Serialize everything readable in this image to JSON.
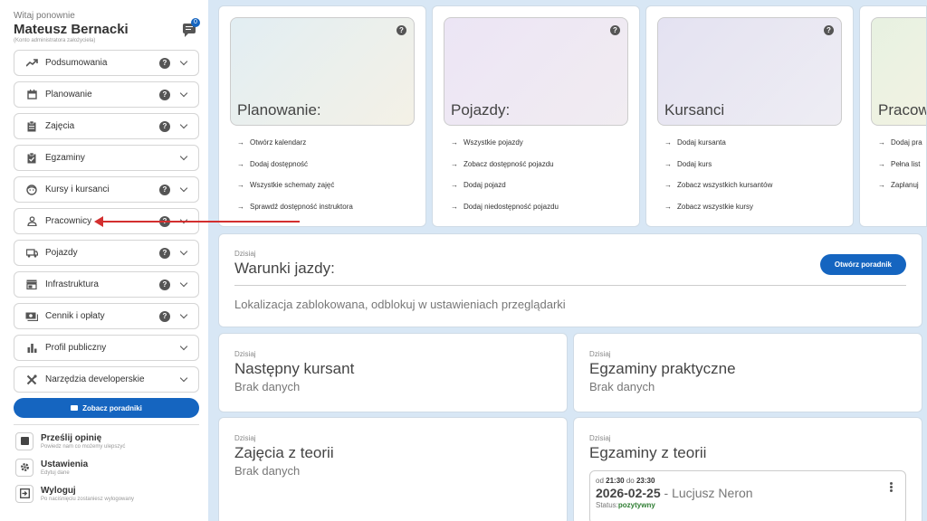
{
  "user": {
    "greeting": "Witaj ponownie",
    "name": "Mateusz Bernacki",
    "role": "(Konto administratora założyciela)",
    "notification_count": "0"
  },
  "menu": [
    {
      "label": "Podsumowania",
      "icon": "trending-up-icon",
      "help": true
    },
    {
      "label": "Planowanie",
      "icon": "calendar-icon",
      "help": true
    },
    {
      "label": "Zajęcia",
      "icon": "clipboard-icon",
      "help": true
    },
    {
      "label": "Egzaminy",
      "icon": "clipboard-check-icon",
      "help": false
    },
    {
      "label": "Kursy i kursanci",
      "icon": "face-icon",
      "help": true
    },
    {
      "label": "Pracownicy",
      "icon": "person-icon",
      "help": true
    },
    {
      "label": "Pojazdy",
      "icon": "car-icon",
      "help": true
    },
    {
      "label": "Infrastruktura",
      "icon": "store-icon",
      "help": true
    },
    {
      "label": "Cennik i opłaty",
      "icon": "payments-icon",
      "help": true
    },
    {
      "label": "Profil publiczny",
      "icon": "bar-chart-icon",
      "help": false
    },
    {
      "label": "Narzędzia developerskie",
      "icon": "tools-icon",
      "help": false
    }
  ],
  "guide_button": "Zobacz poradniki",
  "bottom": [
    {
      "title": "Prześlij opinię",
      "subtitle": "Powiedz nam co możemy ulepszyć"
    },
    {
      "title": "Ustawienia",
      "subtitle": "Edytuj dane"
    },
    {
      "title": "Wyloguj",
      "subtitle": "Po naciśnięciu zostaniesz wylogowany"
    }
  ],
  "quick_cards": [
    {
      "title": "Planowanie:",
      "links": [
        "Otwórz kalendarz",
        "Dodaj dostępność",
        "Wszystkie schematy zajęć",
        "Sprawdź dostępność instruktora"
      ],
      "color_a": "#e2eef3",
      "color_b": "#f4f1e6"
    },
    {
      "title": "Pojazdy:",
      "links": [
        "Wszystkie pojazdy",
        "Zobacz dostępność pojazdu",
        "Dodaj pojazd",
        "Dodaj niedostępność pojazdu"
      ],
      "color_a": "#ece5f5",
      "color_b": "#f1ecf1"
    },
    {
      "title": "Kursanci",
      "links": [
        "Dodaj kursanta",
        "Dodaj kurs",
        "Zobacz wszystkich kursantów",
        "Zobacz wszystkie kursy"
      ],
      "color_a": "#e4e2f2",
      "color_b": "#eeedf3"
    },
    {
      "title": "Pracow",
      "links": [
        "Dodaj pra",
        "Pełna list",
        "Zaplanuj "
      ],
      "color_a": "#e7f1e1",
      "color_b": "#f3f3e3"
    }
  ],
  "weather": {
    "day": "Dzisiaj",
    "title": "Warunki jazdy:",
    "button": "Otwórz poradnik",
    "message": "Lokalizacja zablokowana, odblokuj w ustawieniach przeglądarki"
  },
  "next_student": {
    "day": "Dzisiaj",
    "title": "Następny kursant",
    "value": "Brak danych"
  },
  "practical_exams": {
    "day": "Dzisiaj",
    "title": "Egzaminy praktyczne",
    "value": "Brak danych"
  },
  "theory_classes": {
    "day": "Dzisiaj",
    "title": "Zajęcia z teorii",
    "value": "Brak danych"
  },
  "theory_exams": {
    "day": "Dzisiaj",
    "title": "Egzaminy z teorii",
    "entry": {
      "from_label": "od",
      "from": "21:30",
      "to_label": "do",
      "to": "23:30",
      "date": "2026-02-25",
      "separator": " - ",
      "person": "Lucjusz Neron",
      "status_label": "Status:",
      "status": "pozytywny"
    }
  },
  "colors": {
    "accent": "#1565c0",
    "arrow": "#d32f2f",
    "status_ok": "#2e7d32"
  }
}
